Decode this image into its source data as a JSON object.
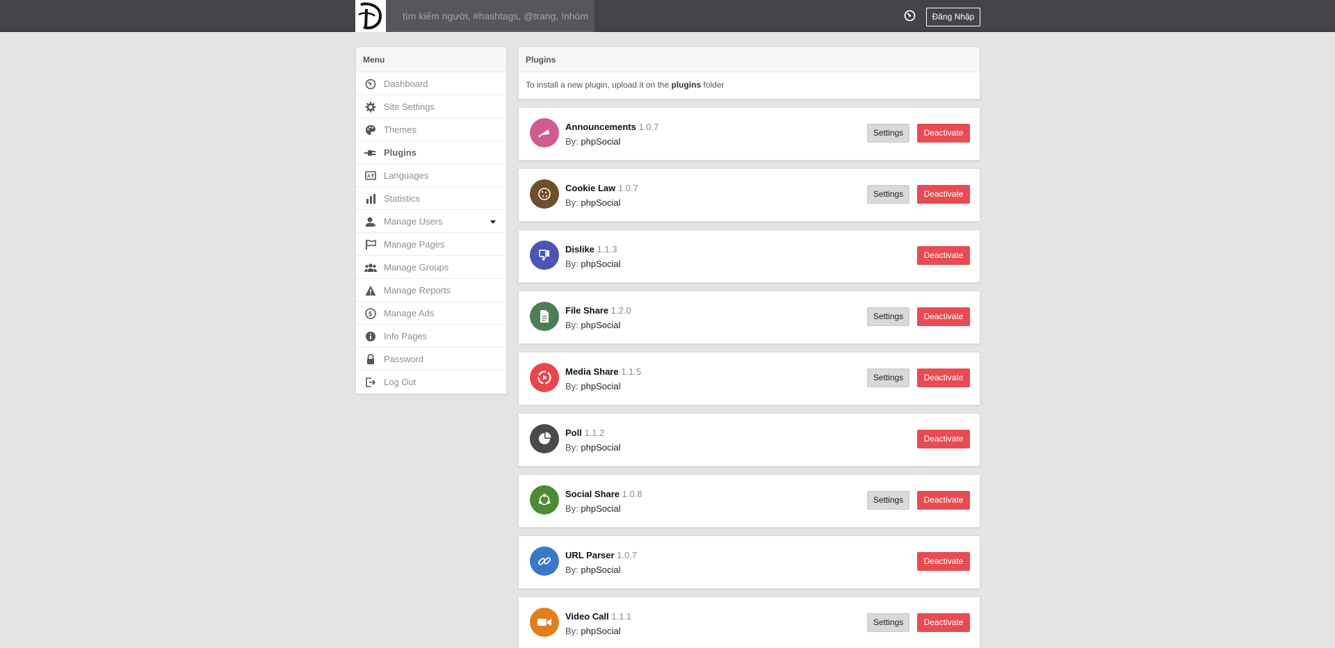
{
  "topbar": {
    "search_placeholder": "tìm kiếm người, #hashtags, @trang, !nhóm",
    "login_label": "Đăng Nhập",
    "icons": {
      "logo": "disney-d-logo",
      "notify": "dashboard-gauge-icon"
    }
  },
  "menu": {
    "title": "Menu",
    "items": [
      {
        "label": "Dashboard",
        "icon": "gauge-icon"
      },
      {
        "label": "Site Settings",
        "icon": "gear-icon"
      },
      {
        "label": "Themes",
        "icon": "palette-icon"
      },
      {
        "label": "Plugins",
        "icon": "plug-icon",
        "active": true
      },
      {
        "label": "Languages",
        "icon": "language-icon"
      },
      {
        "label": "Statistics",
        "icon": "bar-chart-icon"
      },
      {
        "label": "Manage Users",
        "icon": "user-icon",
        "has_dropdown": true
      },
      {
        "label": "Manage Pages",
        "icon": "flag-icon"
      },
      {
        "label": "Manage Groups",
        "icon": "group-icon"
      },
      {
        "label": "Manage Reports",
        "icon": "warning-icon"
      },
      {
        "label": "Manage Ads",
        "icon": "dollar-icon"
      },
      {
        "label": "Info Pages",
        "icon": "info-icon"
      },
      {
        "label": "Password",
        "icon": "lock-icon"
      },
      {
        "label": "Log Out",
        "icon": "logout-icon"
      }
    ]
  },
  "plugins_panel": {
    "title": "Plugins",
    "text_before": "To install a new plugin, upload it on the ",
    "text_bold": "plugins",
    "text_after": " folder"
  },
  "by_label": "By:",
  "settings_label": "Settings",
  "deactivate_label": "Deactivate",
  "plugins": [
    {
      "name": "Announcements",
      "version": "1.0.7",
      "author": "phpSocial",
      "color": "#d05c8e",
      "icon": "megaphone-icon",
      "has_settings": true
    },
    {
      "name": "Cookie Law",
      "version": "1.0.7",
      "author": "phpSocial",
      "color": "#6e4f2c",
      "icon": "cookie-icon",
      "has_settings": true
    },
    {
      "name": "Dislike",
      "version": "1.1.3",
      "author": "phpSocial",
      "color": "#4b55b3",
      "icon": "thumbs-down-icon",
      "has_settings": false
    },
    {
      "name": "File Share",
      "version": "1.2.0",
      "author": "phpSocial",
      "color": "#4e7d55",
      "icon": "file-icon",
      "has_settings": true
    },
    {
      "name": "Media Share",
      "version": "1.1.5",
      "author": "phpSocial",
      "color": "#e8464c",
      "icon": "play-circle-icon",
      "has_settings": true
    },
    {
      "name": "Poll",
      "version": "1.1.2",
      "author": "phpSocial",
      "color": "#4a4a4a",
      "icon": "pie-chart-icon",
      "has_settings": false
    },
    {
      "name": "Social Share",
      "version": "1.0.8",
      "author": "phpSocial",
      "color": "#4e8a34",
      "icon": "share-icon",
      "has_settings": true
    },
    {
      "name": "URL Parser",
      "version": "1.0.7",
      "author": "phpSocial",
      "color": "#3a78c8",
      "icon": "link-icon",
      "has_settings": false
    },
    {
      "name": "Video Call",
      "version": "1.1.1",
      "author": "phpSocial",
      "color": "#e27f1d",
      "icon": "video-camera-icon",
      "has_settings": true
    }
  ]
}
